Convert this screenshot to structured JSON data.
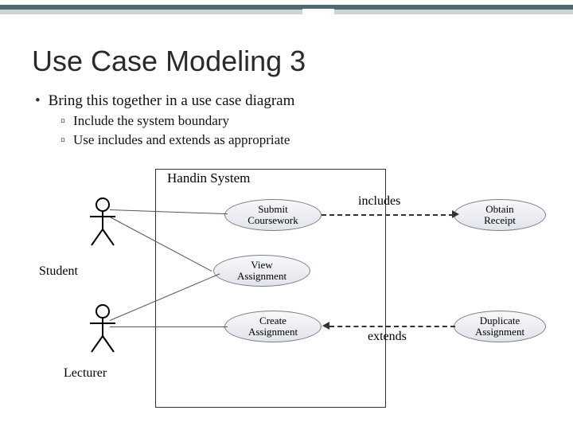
{
  "title": "Use Case Modeling 3",
  "bullets": {
    "main": "Bring this together in a use case diagram",
    "sub1": "Include the system boundary",
    "sub2": "Use includes and extends as appropriate"
  },
  "system": {
    "label": "Handin System"
  },
  "actors": {
    "student": "Student",
    "lecturer": "Lecturer"
  },
  "usecases": {
    "submit": "Submit\nCoursework",
    "view": "View\nAssignment",
    "create": "Create\nAssignment",
    "obtain": "Obtain\nReceipt",
    "duplicate": "Duplicate\nAssignment"
  },
  "relations": {
    "includes": "includes",
    "extends": "extends"
  }
}
